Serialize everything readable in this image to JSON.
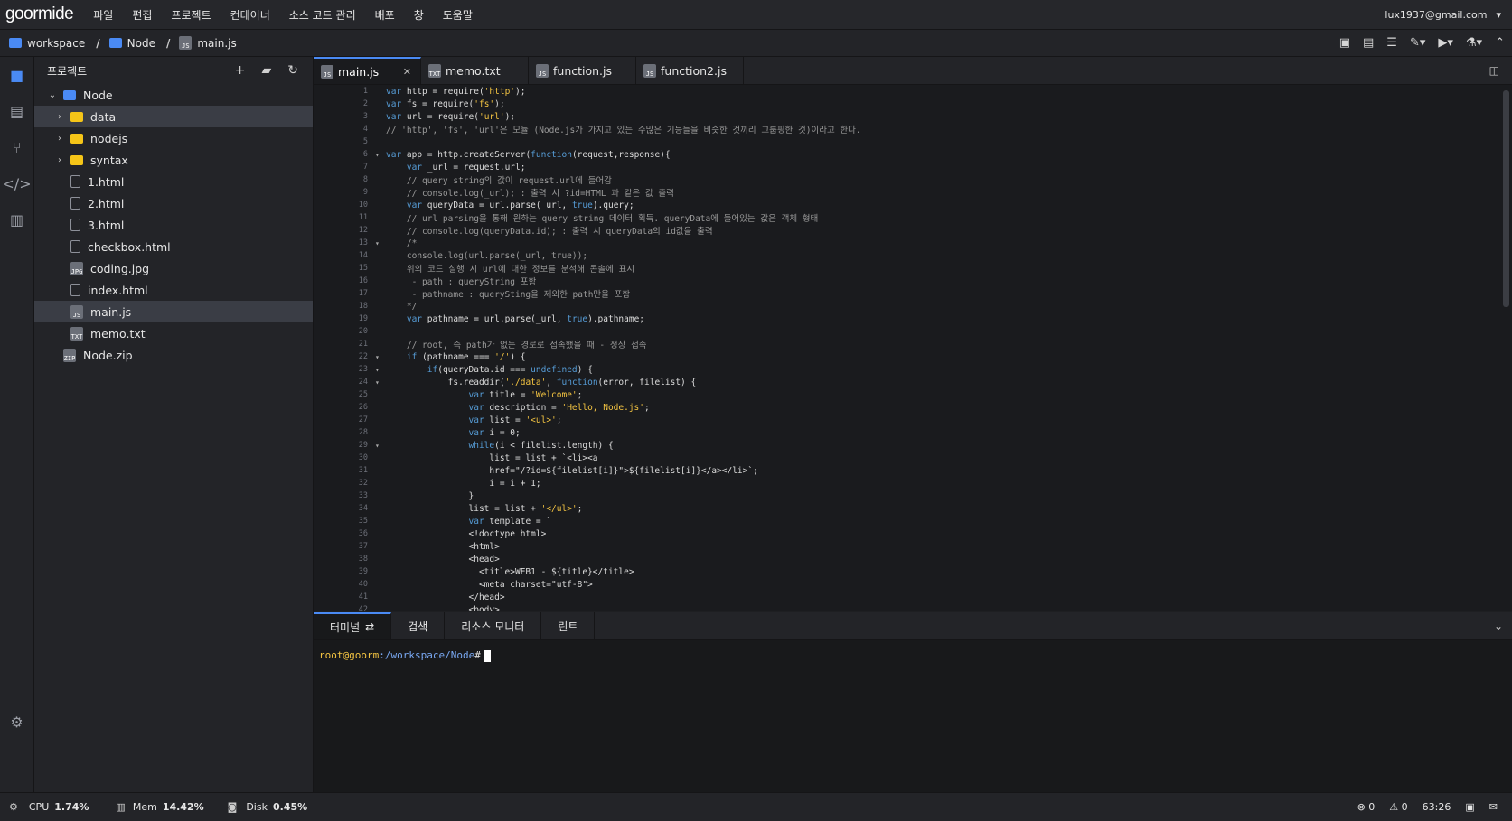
{
  "app": {
    "logo": "goormide",
    "user": "lux1937@gmail.com"
  },
  "menu": [
    "파일",
    "편집",
    "프로젝트",
    "컨테이너",
    "소스 코드 관리",
    "배포",
    "창",
    "도움말"
  ],
  "breadcrumb": {
    "workspace": "workspace",
    "node": "Node",
    "file": "main.js"
  },
  "sidebar": {
    "title": "프로젝트",
    "root": "Node",
    "items": [
      {
        "name": "data",
        "type": "folder",
        "selected": true
      },
      {
        "name": "nodejs",
        "type": "folder"
      },
      {
        "name": "syntax",
        "type": "folder"
      },
      {
        "name": "1.html",
        "type": "html"
      },
      {
        "name": "2.html",
        "type": "html"
      },
      {
        "name": "3.html",
        "type": "html"
      },
      {
        "name": "checkbox.html",
        "type": "html"
      },
      {
        "name": "coding.jpg",
        "type": "jpg"
      },
      {
        "name": "index.html",
        "type": "html"
      },
      {
        "name": "main.js",
        "type": "js",
        "selected": true
      },
      {
        "name": "memo.txt",
        "type": "txt"
      }
    ],
    "zip": "Node.zip"
  },
  "tabs": [
    {
      "label": "main.js",
      "badge": "JS"
    },
    {
      "label": "memo.txt",
      "badge": "TXT"
    },
    {
      "label": "function.js",
      "badge": "JS"
    },
    {
      "label": "function2.js",
      "badge": "JS"
    }
  ],
  "code": [
    {
      "n": "1",
      "t": "var http = require('http');"
    },
    {
      "n": "2",
      "t": "var fs = require('fs');"
    },
    {
      "n": "3",
      "t": "var url = require('url');"
    },
    {
      "n": "4",
      "t": "// 'http', 'fs', 'url'은 모듈 (Node.js가 가지고 있는 수많은 기능들을 비슷한 것끼리 그룹핑한 것)이라고 한다."
    },
    {
      "n": "5",
      "t": ""
    },
    {
      "n": "6",
      "t": "var app = http.createServer(function(request,response){",
      "f": "▾"
    },
    {
      "n": "7",
      "t": "    var _url = request.url;"
    },
    {
      "n": "8",
      "t": "    // query string의 값이 request.url에 들어감"
    },
    {
      "n": "9",
      "t": "    // console.log(_url); : 출력 시 ?id=HTML 과 같은 값 출력"
    },
    {
      "n": "10",
      "t": "    var queryData = url.parse(_url, true).query;"
    },
    {
      "n": "11",
      "t": "    // url parsing을 통해 원하는 query string 데이터 획득. queryData에 들어있는 값은 객체 형태"
    },
    {
      "n": "12",
      "t": "    // console.log(queryData.id); : 출력 시 queryData의 id값을 출력"
    },
    {
      "n": "13",
      "t": "    /*",
      "f": "▾"
    },
    {
      "n": "14",
      "t": "    console.log(url.parse(_url, true));"
    },
    {
      "n": "15",
      "t": "    위의 코드 실행 시 url에 대한 정보를 분석해 콘솔에 표시"
    },
    {
      "n": "16",
      "t": "     - path : queryString 포함"
    },
    {
      "n": "17",
      "t": "     - pathname : querySting을 제외한 path만을 포함"
    },
    {
      "n": "18",
      "t": "    */"
    },
    {
      "n": "19",
      "t": "    var pathname = url.parse(_url, true).pathname;"
    },
    {
      "n": "20",
      "t": ""
    },
    {
      "n": "21",
      "t": "    // root, 즉 path가 없는 경로로 접속했을 때 - 정상 접속"
    },
    {
      "n": "22",
      "t": "    if (pathname === '/') {",
      "f": "▾"
    },
    {
      "n": "23",
      "t": "        if(queryData.id === undefined) {",
      "f": "▾"
    },
    {
      "n": "24",
      "t": "            fs.readdir('./data', function(error, filelist) {",
      "f": "▾"
    },
    {
      "n": "25",
      "t": "                var title = 'Welcome';"
    },
    {
      "n": "26",
      "t": "                var description = 'Hello, Node.js';"
    },
    {
      "n": "27",
      "t": "                var list = '<ul>';"
    },
    {
      "n": "28",
      "t": "                var i = 0;"
    },
    {
      "n": "29",
      "t": "                while(i < filelist.length) {",
      "f": "▾"
    },
    {
      "n": "30",
      "t": "                    list = list + `<li><a"
    },
    {
      "n": "31",
      "t": "                    href=\"/?id=${filelist[i]}\">${filelist[i]}</a></li>`;"
    },
    {
      "n": "32",
      "t": "                    i = i + 1;"
    },
    {
      "n": "33",
      "t": "                }"
    },
    {
      "n": "34",
      "t": "                list = list + '</ul>';"
    },
    {
      "n": "35",
      "t": "                var template = `"
    },
    {
      "n": "36",
      "t": "                <!doctype html>"
    },
    {
      "n": "37",
      "t": "                <html>"
    },
    {
      "n": "38",
      "t": "                <head>"
    },
    {
      "n": "39",
      "t": "                  <title>WEB1 - ${title}</title>"
    },
    {
      "n": "40",
      "t": "                  <meta charset=\"utf-8\">"
    },
    {
      "n": "41",
      "t": "                </head>"
    },
    {
      "n": "42",
      "t": "                <body>"
    }
  ],
  "terminal": {
    "tabs": [
      "터미널",
      "검색",
      "리소스 모니터",
      "린트"
    ],
    "user": "root@goorm",
    "path": ":/workspace/Node",
    "suffix": "#"
  },
  "status": {
    "cpu_label": "CPU",
    "cpu": "1.74%",
    "mem_label": "Mem",
    "mem": "14.42%",
    "disk_label": "Disk",
    "disk": "0.45%",
    "errors": "0",
    "warnings": "0",
    "position": "63:26"
  },
  "colors": {
    "accent": "#4a8af4",
    "folder": "#f5c518",
    "keyword": "#569cd6",
    "string": "#f5c542",
    "comment": "#9a9a9a"
  }
}
